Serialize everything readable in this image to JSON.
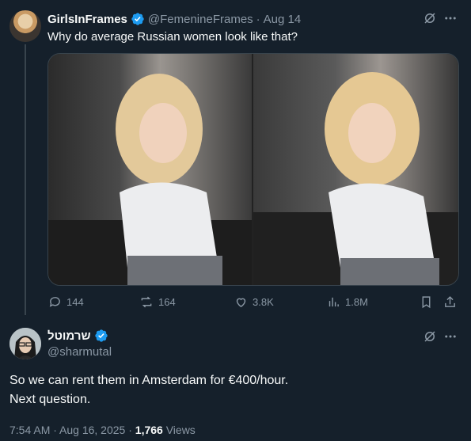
{
  "quoted_post": {
    "display_name": "GirlsInFrames",
    "handle": "@FemenineFrames",
    "separator": "·",
    "date": "Aug 14",
    "text": "Why do average Russian women look like that?",
    "actions": {
      "replies": "144",
      "reposts": "164",
      "likes": "3.8K",
      "views": "1.8M"
    }
  },
  "main_post": {
    "display_name": "שרמוטל",
    "handle": "@sharmutal",
    "text_line1": "So we can rent them in Amsterdam for €400/hour.",
    "text_line2": "Next question.",
    "timestamp": "7:54 AM · Aug 16, 2025 · ",
    "views_count": "1,766",
    "views_label": " Views"
  },
  "colors": {
    "background": "#15202b",
    "text": "#f7f9f9",
    "muted": "#8b98a5",
    "verified": "#1d9bf0",
    "border": "#38444d"
  }
}
